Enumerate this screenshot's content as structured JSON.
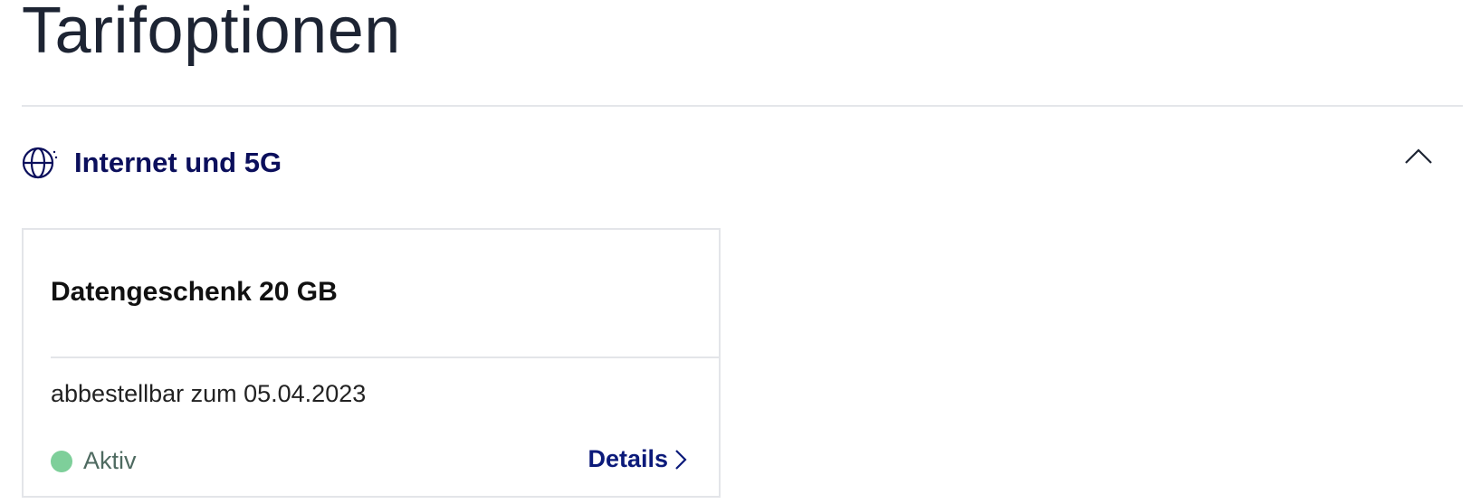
{
  "page": {
    "title": "Tarifoptionen"
  },
  "section": {
    "title": "Internet und 5G",
    "icon": "globe-icon",
    "toggle_icon": "chevron-up-icon",
    "expanded": true
  },
  "card": {
    "title": "Datengeschenk 20 GB",
    "subtext": "abbestellbar zum 05.04.2023",
    "status_label": "Aktiv",
    "status_color": "#7ecf9a",
    "details_label": "Details",
    "details_icon": "chevron-right-icon"
  },
  "colors": {
    "heading": "#1d2433",
    "accent_navy": "#0b0f5c",
    "link": "#0b1a7a",
    "border": "#e3e5e9"
  }
}
